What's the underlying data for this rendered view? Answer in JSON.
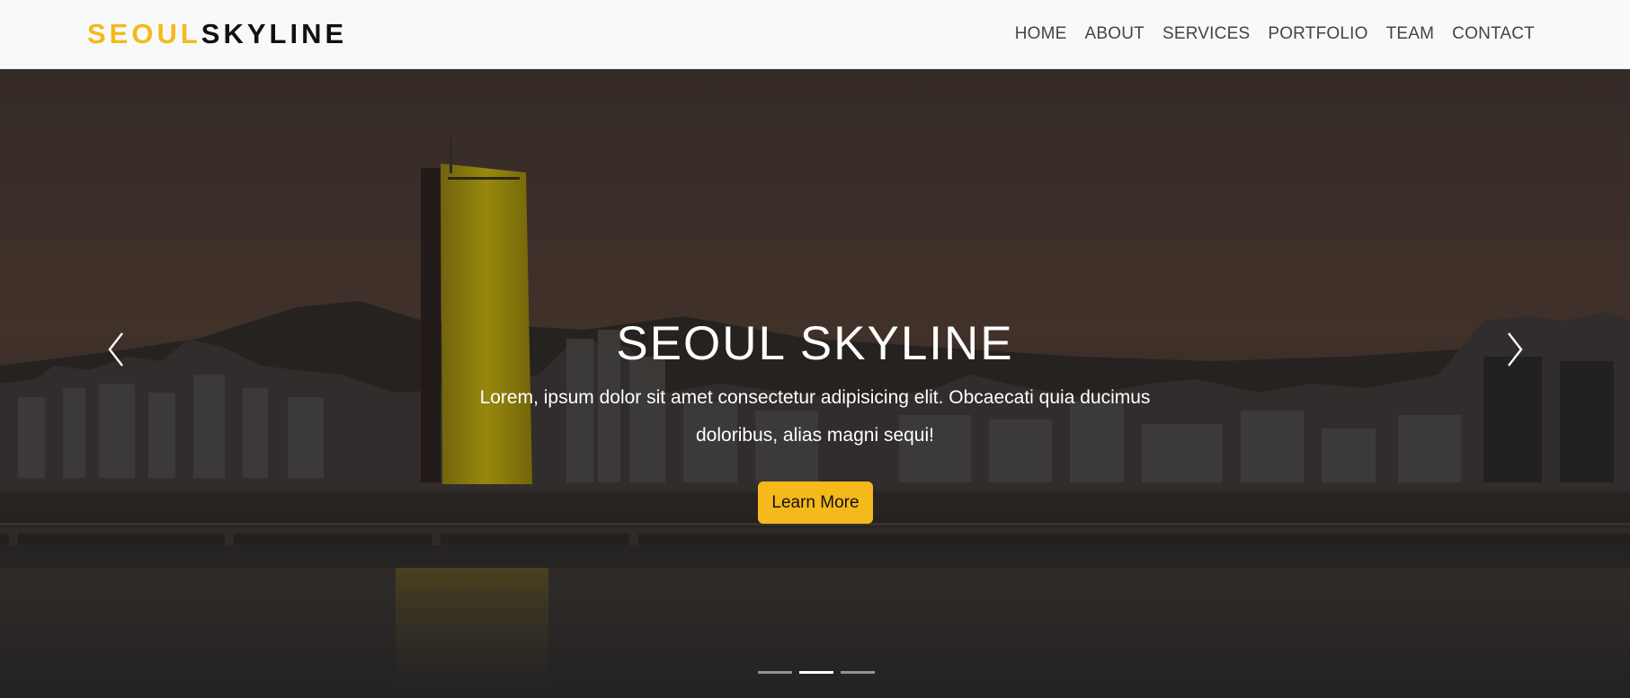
{
  "brand": {
    "part1": "SEOUL",
    "part2": "SKYLINE"
  },
  "nav": {
    "items": [
      "HOME",
      "ABOUT",
      "SERVICES",
      "PORTFOLIO",
      "TEAM",
      "CONTACT"
    ]
  },
  "hero": {
    "title": "SEOUL SKYLINE",
    "subtitle": "Lorem, ipsum dolor sit amet consectetur adipisicing elit. Obcaecati quia ducimus doloribus, alias magni sequi!",
    "button_label": "Learn More",
    "slides_total": 3,
    "active_slide": 2
  },
  "colors": {
    "accent": "#f5b91b",
    "brand_dark": "#111111",
    "nav_text": "#444444"
  },
  "icons": {
    "prev": "chevron-left-icon",
    "next": "chevron-right-icon"
  }
}
